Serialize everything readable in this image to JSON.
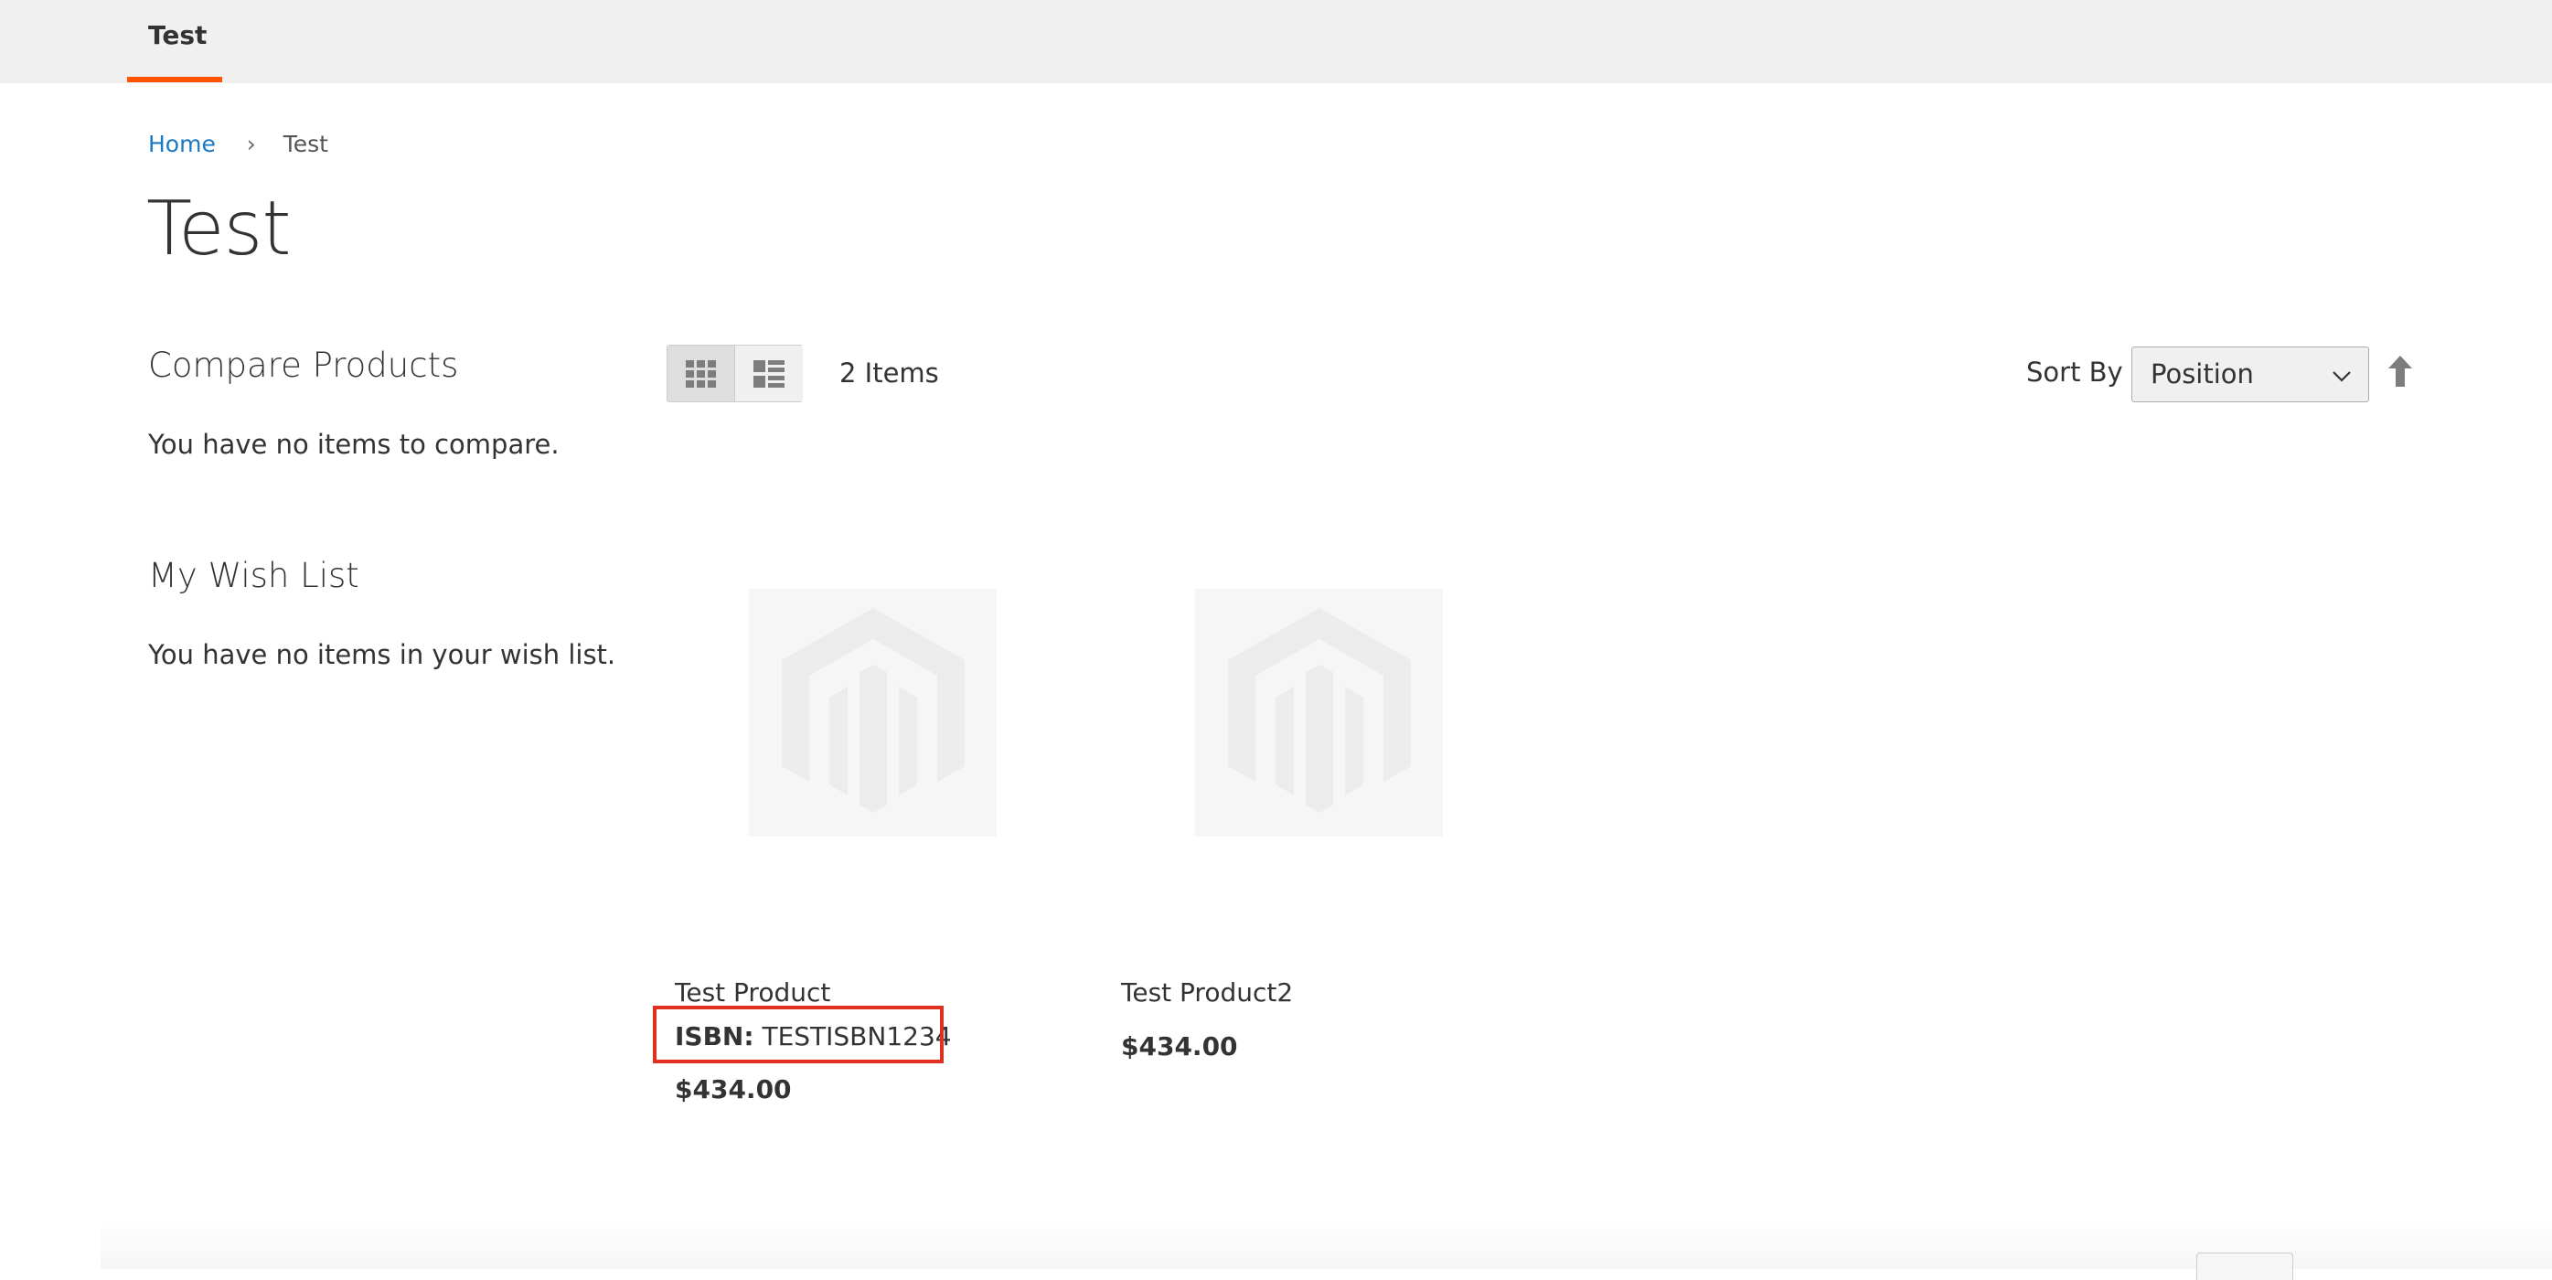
{
  "nav": {
    "item": "Test",
    "accent_color": "#ff5501"
  },
  "breadcrumb": {
    "home": "Home",
    "separator": "›",
    "current": "Test"
  },
  "page_title": "Test",
  "sidebar": {
    "compare_title": "Compare Products",
    "compare_text": "You have no items to compare.",
    "wishlist_title": "My Wish List",
    "wishlist_text": "You have no items in your wish list."
  },
  "toolbar": {
    "items_count": "2 Items",
    "sort_label": "Sort By",
    "sort_value": "Position",
    "view_modes": [
      "grid-icon",
      "list-icon"
    ],
    "active_view": "grid"
  },
  "products": [
    {
      "name": "Test Product",
      "isbn_label": "ISBN:",
      "isbn_value": "TESTISBN1234",
      "price": "$434.00"
    },
    {
      "name": "Test Product2",
      "price": "$434.00"
    }
  ],
  "colors": {
    "link": "#1979c3",
    "highlight": "#e0301e"
  }
}
